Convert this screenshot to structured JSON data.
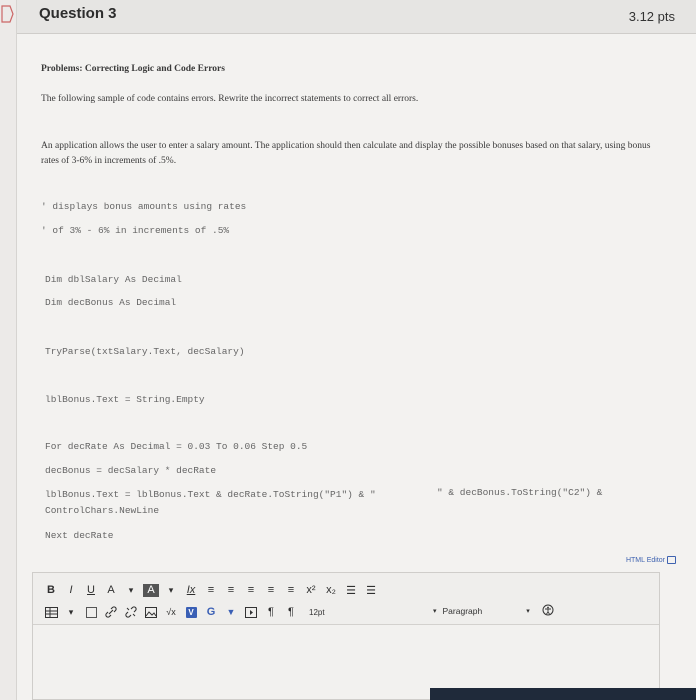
{
  "question": {
    "title": "Question 3",
    "points": "3.12 pts"
  },
  "content": {
    "problems_title": "Problems: Correcting Logic and Code Errors",
    "intro": "The following sample of code contains errors. Rewrite the incorrect statements to correct all errors.",
    "description": "An application allows the user to enter a salary amount. The application should then calculate and display the possible bonuses based on that salary, using bonus rates of 3-6% in increments of .5%."
  },
  "code": {
    "comment1": "' displays bonus amounts using rates",
    "comment2": "' of 3% - 6% in increments of .5%",
    "dim1": "Dim dblSalary As Decimal",
    "dim2": "Dim decBonus As Decimal",
    "tryparse": "TryParse(txtSalary.Text, decSalary)",
    "lblclear": "lblBonus.Text = String.Empty",
    "forloop": "For decRate As Decimal = 0.03 To 0.06 Step 0.5",
    "calc": "decBonus = decSalary * decRate",
    "line_a": "lblBonus.Text = lblBonus.Text & decRate.ToString(\"P1\") & \"",
    "line_b": "\" & decBonus.ToString(\"C2\") &",
    "line_c": "ControlChars.NewLine",
    "next": "Next decRate"
  },
  "editor": {
    "html_editor_label": "HTML Editor",
    "toolbar_row1": [
      "B",
      "I",
      "U",
      "A",
      "▾",
      "A",
      "▾",
      "Ix",
      "≡",
      "≡",
      "≡",
      "≡",
      "≡",
      "x²",
      "x₂",
      "☰",
      "☰"
    ],
    "font_size": "12pt",
    "paragraph": "Paragraph"
  }
}
